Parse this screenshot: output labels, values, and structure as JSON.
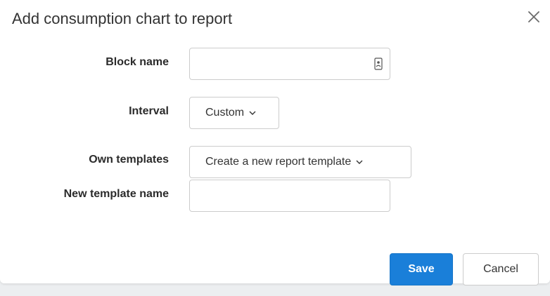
{
  "dialog": {
    "title": "Add consumption chart to report",
    "close_icon": "close-icon"
  },
  "form": {
    "block_name": {
      "label": "Block name",
      "value": "",
      "placeholder": "",
      "icon": "autofill-contact-icon"
    },
    "interval": {
      "label": "Interval",
      "selected": "Custom",
      "icon": "chevron-down-icon"
    },
    "own_templates": {
      "label": "Own templates",
      "selected": "Create a new report template",
      "icon": "chevron-down-icon"
    },
    "new_template_name": {
      "label": "New template name",
      "value": "",
      "placeholder": ""
    }
  },
  "footer": {
    "save_label": "Save",
    "cancel_label": "Cancel"
  },
  "colors": {
    "primary": "#1a7fd9",
    "border": "#cccccc",
    "text": "#333333"
  }
}
